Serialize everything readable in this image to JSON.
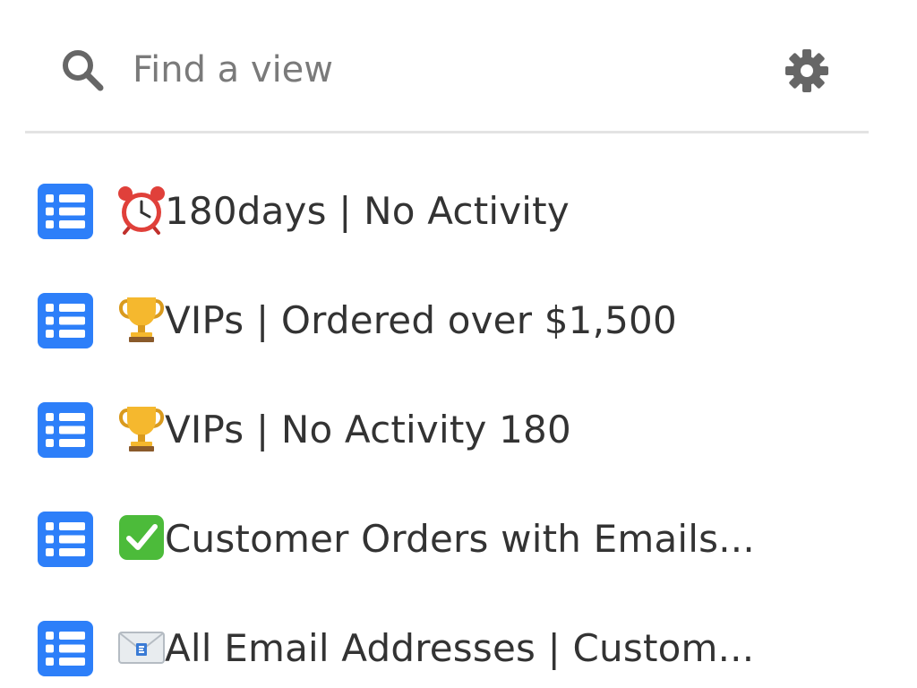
{
  "search": {
    "placeholder": "Find a view",
    "value": ""
  },
  "icons": {
    "search": "search-icon",
    "settings": "gear-icon",
    "view_type": "grid-view-icon"
  },
  "colors": {
    "grid_icon": "#2d7ff9",
    "icon_gray": "#666666",
    "divider": "#e3e3e3"
  },
  "views": [
    {
      "emoji": "alarm-clock",
      "label": "180days | No Activity"
    },
    {
      "emoji": "trophy",
      "label": "VIPs | Ordered over $1,500"
    },
    {
      "emoji": "trophy",
      "label": "VIPs | No Activity 180"
    },
    {
      "emoji": "check-mark-button",
      "label": "Customer Orders with Emails..."
    },
    {
      "emoji": "e-mail",
      "label": "All Email Addresses | Custom..."
    }
  ]
}
